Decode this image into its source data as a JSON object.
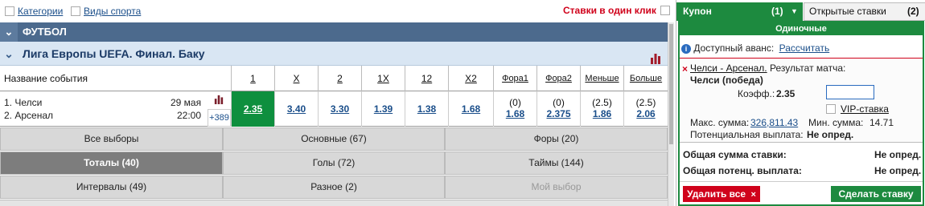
{
  "topbar": {
    "categories": "Категории",
    "sports_view": "Виды спорта",
    "one_click": "Ставки в один клик"
  },
  "sport": {
    "title": "ФУТБОЛ"
  },
  "league": {
    "title": "Лига Европы UEFA. Финал. Баку"
  },
  "table": {
    "name_header": "Название события",
    "columns": [
      "1",
      "X",
      "2",
      "1X",
      "12",
      "X2",
      "Фора1",
      "Фора2",
      "Меньше",
      "Больше"
    ]
  },
  "event": {
    "team1": "1. Челси",
    "team2": "2. Арсенал",
    "date": "29 мая",
    "time": "22:00",
    "more": "+389",
    "odds": [
      "2.35",
      "3.40",
      "3.30",
      "1.39",
      "1.38",
      "1.68"
    ],
    "handicap1": {
      "param": "(0)",
      "value": "1.68"
    },
    "handicap2": {
      "param": "(0)",
      "value": "2.375"
    },
    "under": {
      "param": "(2.5)",
      "value": "1.86"
    },
    "over": {
      "param": "(2.5)",
      "value": "2.06"
    }
  },
  "markets": [
    "Все выборы",
    "Основные (67)",
    "Форы (20)",
    "Тоталы (40)",
    "Голы (72)",
    "Таймы (144)",
    "Интервалы (49)",
    "Разное (2)",
    "Мой выбор"
  ],
  "coupon": {
    "tab_coupon": "Купон",
    "tab_count": "(1)",
    "tab_open": "Открытые ставки",
    "open_count": "(2)",
    "singles": "Одиночные",
    "advance": "Доступный аванс:",
    "calculate": "Рассчитать",
    "match": "Челси - Арсенал.",
    "market": "Результат матча:",
    "pick": "Челси (победа)",
    "coef_label": "Коэфф.:",
    "coef": "2.35",
    "vip": "VIP-ставка",
    "max_label": "Макс. сумма:",
    "max_value": "326,811.43",
    "min_label": "Мин. сумма:",
    "min_value": "14.71",
    "potential_label": "Потенциальная выплата:",
    "potential_value": "Не опред.",
    "total_stake_label": "Общая сумма ставки:",
    "total_stake_value": "Не опред.",
    "total_payout_label": "Общая потенц. выплата:",
    "total_payout_value": "Не опред.",
    "delete_all": "Удалить все",
    "make_bet": "Сделать ставку"
  },
  "colors": {
    "accent_green": "#1d8a3f",
    "header_blue": "#4c6a8d",
    "red": "#d0021b"
  }
}
